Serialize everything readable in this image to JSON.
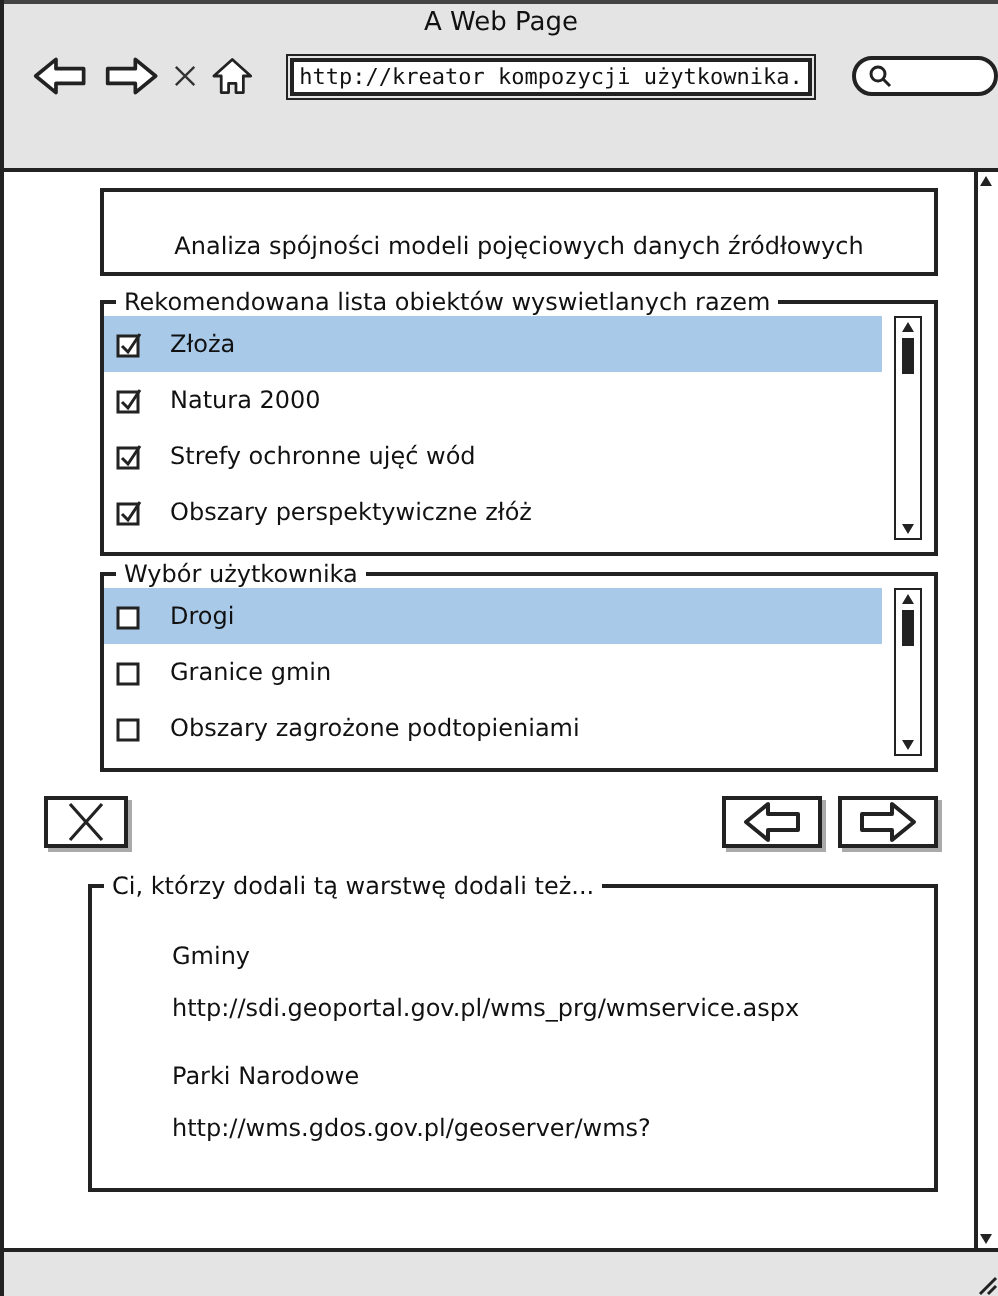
{
  "window": {
    "title": "A Web Page"
  },
  "address_bar": {
    "value": "http://kreator kompozycji użytkownika."
  },
  "header": {
    "text": "Analiza spójności modeli pojęciowych danych źródłowych"
  },
  "recommended": {
    "legend": "Rekomendowana lista obiektów wyswietlanych razem",
    "items": [
      {
        "label": "Złoża",
        "checked": true,
        "selected": true
      },
      {
        "label": "Natura 2000",
        "checked": true,
        "selected": false
      },
      {
        "label": "Strefy ochronne ujęć wód",
        "checked": true,
        "selected": false
      },
      {
        "label": "Obszary perspektywiczne złóż",
        "checked": true,
        "selected": false
      }
    ]
  },
  "user_selection": {
    "legend": "Wybór użytkownika",
    "items": [
      {
        "label": "Drogi",
        "checked": false,
        "selected": true
      },
      {
        "label": "Granice gmin",
        "checked": false,
        "selected": false
      },
      {
        "label": "Obszary zagrożone podtopieniami",
        "checked": false,
        "selected": false
      }
    ]
  },
  "also_added": {
    "legend": "Ci, którzy dodali tą warstwę dodali też...",
    "entries": [
      {
        "name": "Gminy",
        "url": "http://sdi.geoportal.gov.pl/wms_prg/wmservice.aspx"
      },
      {
        "name": "Parki Narodowe",
        "url": "http://wms.gdos.gov.pl/geoserver/wms?"
      }
    ]
  }
}
